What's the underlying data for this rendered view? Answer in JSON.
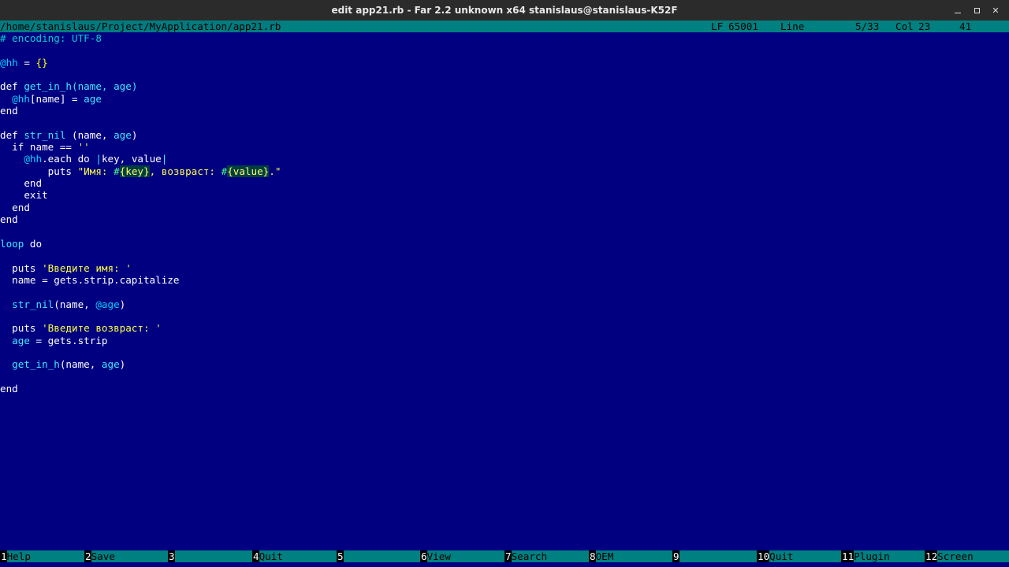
{
  "window": {
    "title": "edit app21.rb - Far 2.2 unknown x64 stanislaus@stanislaus-K52F",
    "controls": {
      "minimize": "minimize-icon",
      "maximize": "maximize-icon",
      "close": "close-icon",
      "close_glyph": "✕"
    }
  },
  "status": {
    "path": "/home/stanislaus/Project/MyApplication/app21.rb",
    "line_ending": "LF",
    "codepage": "65001",
    "line_label": "Line",
    "position": "5/33",
    "col_label": "Col",
    "col": "23",
    "char_code": "41"
  },
  "editor": {
    "lines": [
      [
        {
          "t": "# encoding: UTF-8",
          "c": "cm"
        }
      ],
      [],
      [
        {
          "t": "@hh",
          "c": "iv"
        },
        {
          "t": " = ",
          "c": "id"
        },
        {
          "t": "{}",
          "c": "br"
        }
      ],
      [],
      [
        {
          "t": "def ",
          "c": "kw"
        },
        {
          "t": "get_in_h",
          "c": "fn"
        },
        {
          "t": "(name, age)",
          "c": "ar"
        }
      ],
      [
        {
          "t": "  ",
          "c": "id"
        },
        {
          "t": "@hh",
          "c": "iv"
        },
        {
          "t": "[name] = ",
          "c": "id"
        },
        {
          "t": "age",
          "c": "ar"
        }
      ],
      [
        {
          "t": "end",
          "c": "kw"
        }
      ],
      [],
      [
        {
          "t": "def ",
          "c": "kw"
        },
        {
          "t": "str_nil",
          "c": "fn"
        },
        {
          "t": " (name, ",
          "c": "id"
        },
        {
          "t": "age",
          "c": "ar"
        },
        {
          "t": ")",
          "c": "id"
        }
      ],
      [
        {
          "t": "  if name == ",
          "c": "id"
        },
        {
          "t": "''",
          "c": "st1"
        }
      ],
      [
        {
          "t": "    ",
          "c": "id"
        },
        {
          "t": "@hh",
          "c": "iv"
        },
        {
          "t": ".each do ",
          "c": "id"
        },
        {
          "t": "|",
          "c": "ar"
        },
        {
          "t": "key, value",
          "c": "id"
        },
        {
          "t": "|",
          "c": "ar"
        }
      ],
      [
        {
          "t": "        puts ",
          "c": "id"
        },
        {
          "t": "\"Имя: ",
          "c": "st1"
        },
        {
          "t": "#",
          "c": "interp"
        },
        {
          "t": "{key}",
          "c": "hl"
        },
        {
          "t": ", возврaст: ",
          "c": "st1"
        },
        {
          "t": "#",
          "c": "interp"
        },
        {
          "t": "{value}",
          "c": "hl"
        },
        {
          "t": ".\"",
          "c": "st1"
        }
      ],
      [
        {
          "t": "    end",
          "c": "kw"
        }
      ],
      [
        {
          "t": "    exit",
          "c": "id"
        }
      ],
      [
        {
          "t": "  end",
          "c": "kw"
        }
      ],
      [
        {
          "t": "end",
          "c": "kw"
        }
      ],
      [],
      [
        {
          "t": "loop",
          "c": "fn"
        },
        {
          "t": " do",
          "c": "kw"
        }
      ],
      [],
      [
        {
          "t": "  puts ",
          "c": "id"
        },
        {
          "t": "'Введите имя: '",
          "c": "st1"
        }
      ],
      [
        {
          "t": "  name = gets.strip.capitalize",
          "c": "id"
        }
      ],
      [],
      [
        {
          "t": "  ",
          "c": "id"
        },
        {
          "t": "str_nil",
          "c": "fn"
        },
        {
          "t": "(name, ",
          "c": "id"
        },
        {
          "t": "@age",
          "c": "iv"
        },
        {
          "t": ")",
          "c": "id"
        }
      ],
      [],
      [
        {
          "t": "  puts ",
          "c": "id"
        },
        {
          "t": "'Введите возврaст: '",
          "c": "st1"
        }
      ],
      [
        {
          "t": "  ",
          "c": "id"
        },
        {
          "t": "age",
          "c": "ar"
        },
        {
          "t": " = gets.strip",
          "c": "id"
        }
      ],
      [],
      [
        {
          "t": "  ",
          "c": "id"
        },
        {
          "t": "get_in_h",
          "c": "fn"
        },
        {
          "t": "(name, ",
          "c": "id"
        },
        {
          "t": "age",
          "c": "ar"
        },
        {
          "t": ")",
          "c": "id"
        }
      ],
      [],
      [
        {
          "t": "end",
          "c": "kw"
        }
      ]
    ]
  },
  "keybar": [
    {
      "num": "1",
      "label": "Help"
    },
    {
      "num": "2",
      "label": "Save"
    },
    {
      "num": "3",
      "label": ""
    },
    {
      "num": "4",
      "label": "Quit"
    },
    {
      "num": "5",
      "label": ""
    },
    {
      "num": "6",
      "label": "View"
    },
    {
      "num": "7",
      "label": "Search"
    },
    {
      "num": "8",
      "label": "OEM"
    },
    {
      "num": "9",
      "label": ""
    },
    {
      "num": "10",
      "label": "Quit"
    },
    {
      "num": "11",
      "label": "Plugin"
    },
    {
      "num": "12",
      "label": "Screen"
    }
  ],
  "colors": {
    "background": "#000080",
    "status_bar": "#008080",
    "title_bar": "#2b2b2b"
  }
}
